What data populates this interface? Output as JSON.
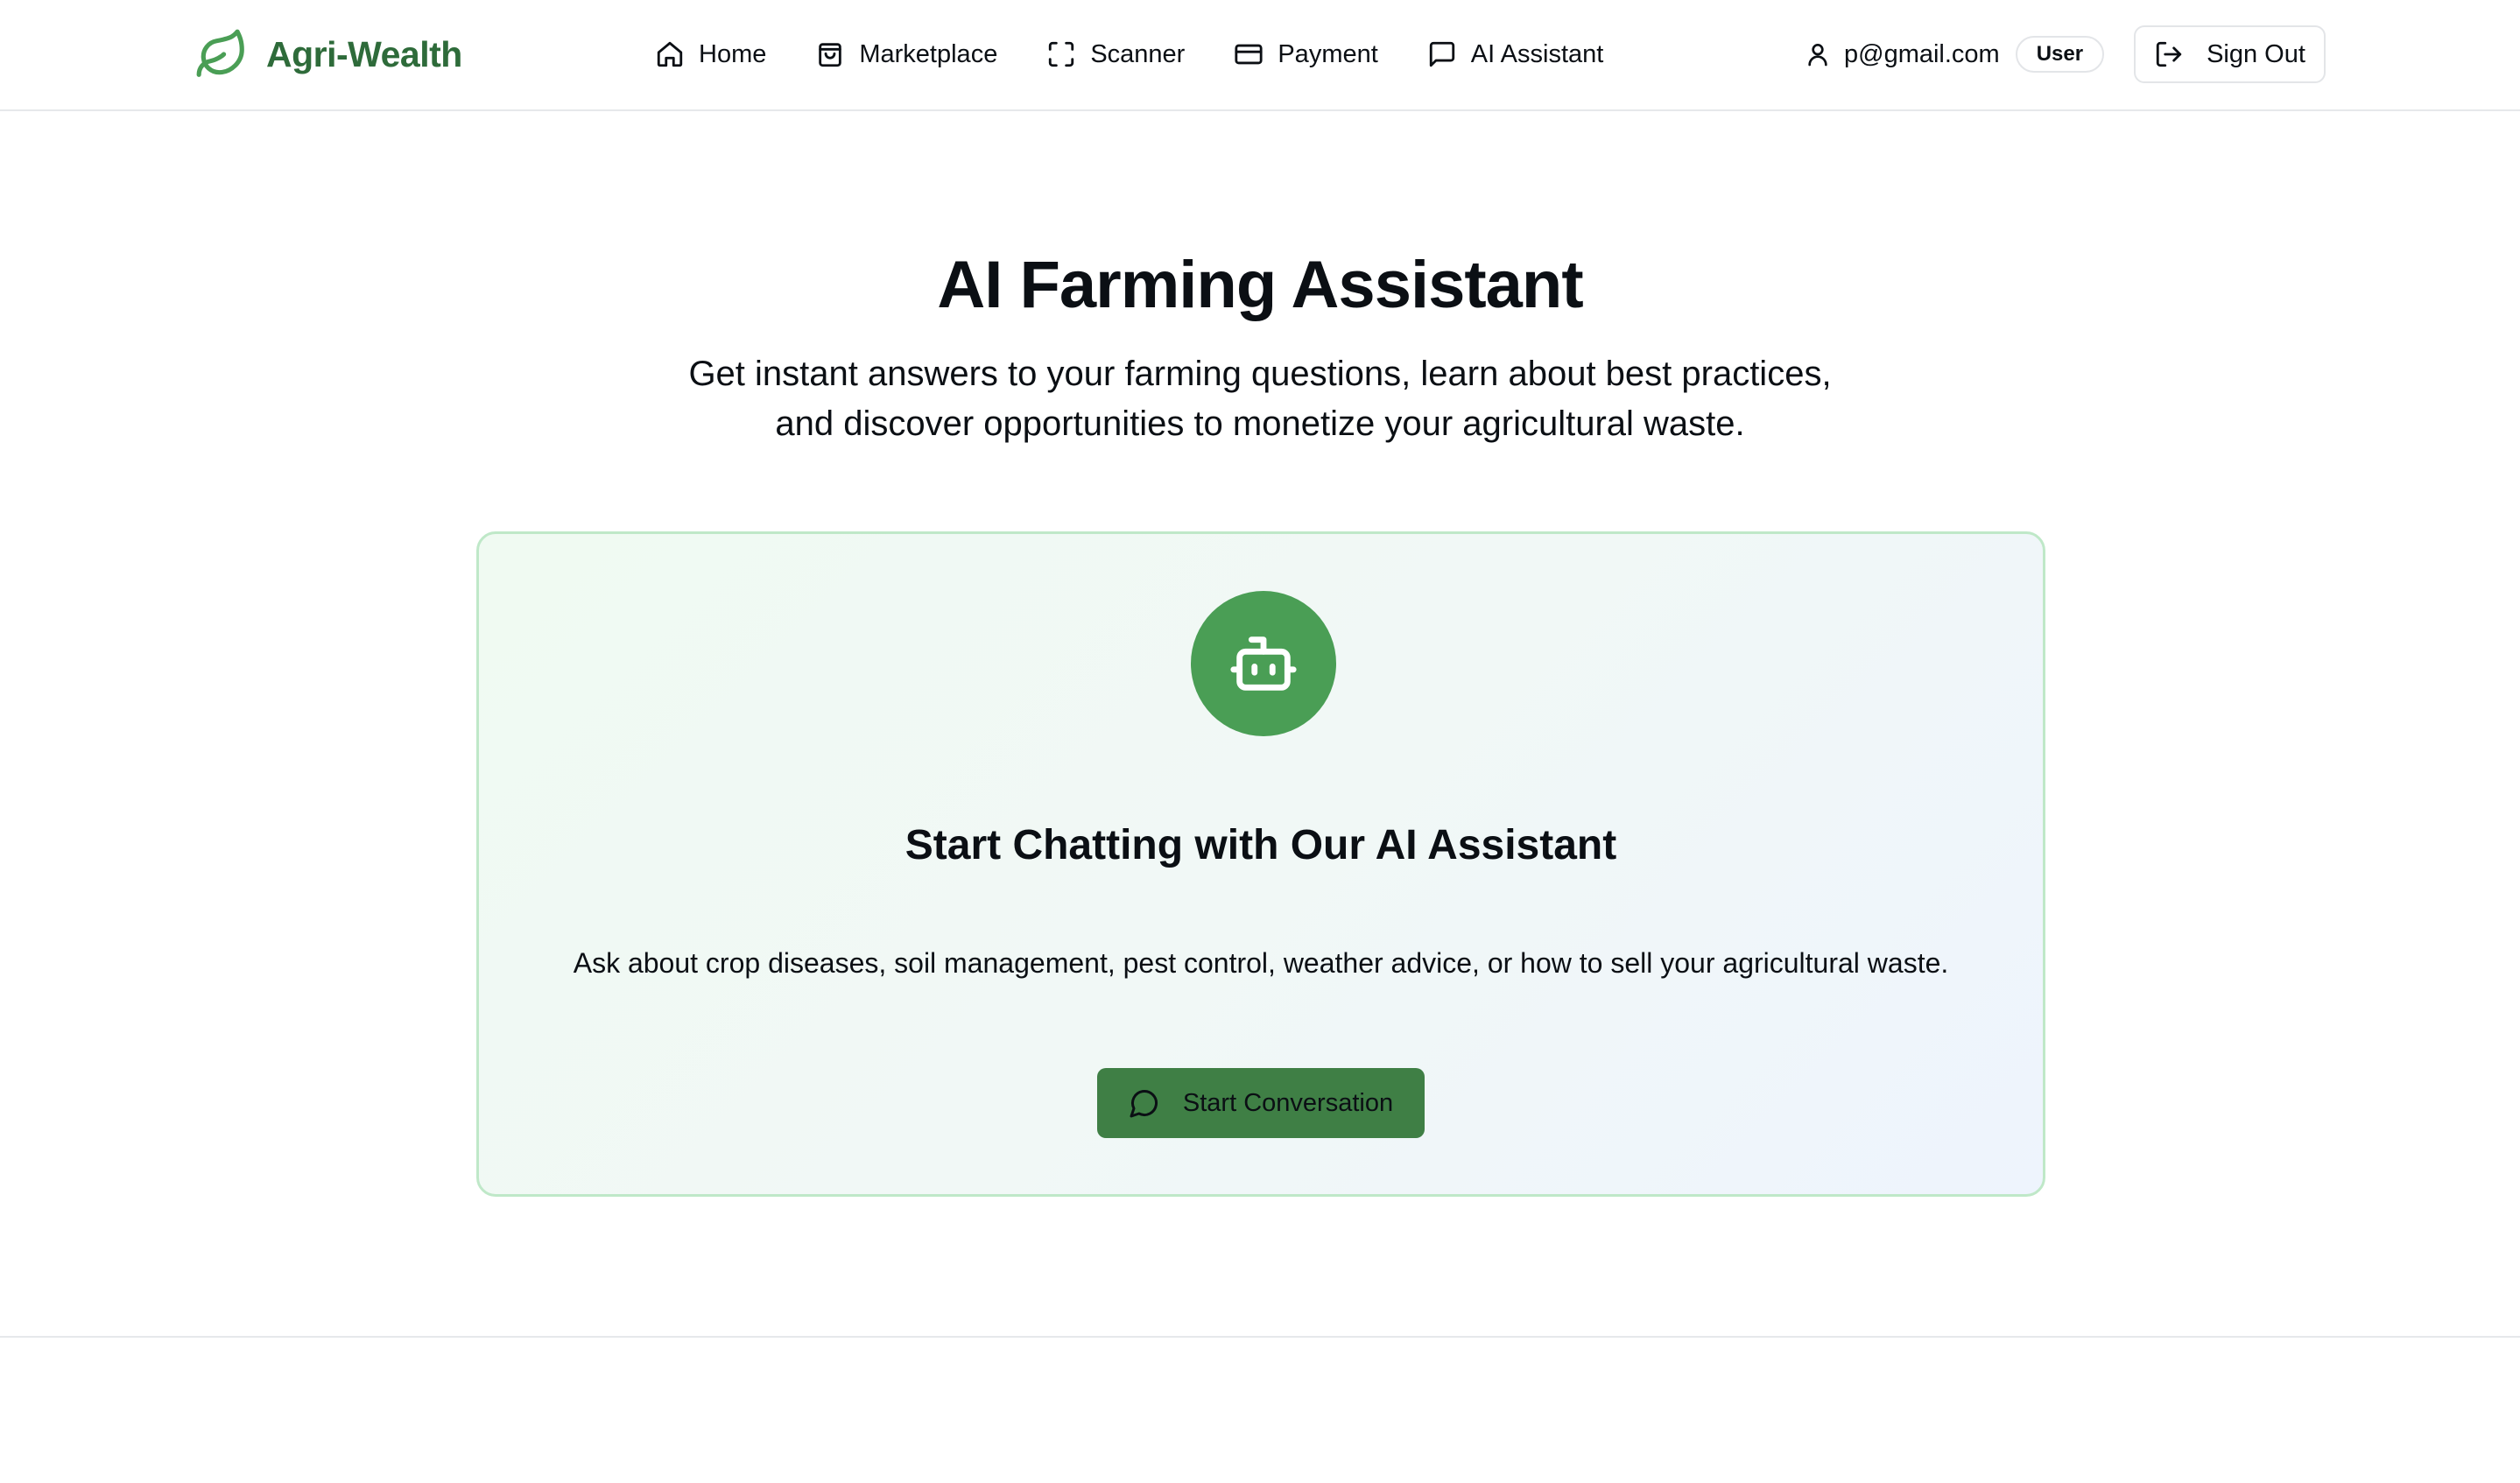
{
  "brand": {
    "name": "Agri-Wealth",
    "logo_icon": "leaf-icon",
    "color": "#2e6b3a"
  },
  "nav": {
    "items": [
      {
        "label": "Home",
        "icon": "home-icon"
      },
      {
        "label": "Marketplace",
        "icon": "shopping-bag-icon"
      },
      {
        "label": "Scanner",
        "icon": "scan-icon"
      },
      {
        "label": "Payment",
        "icon": "credit-card-icon"
      },
      {
        "label": "AI Assistant",
        "icon": "chat-square-icon"
      }
    ]
  },
  "user": {
    "email": "p@gmail.com",
    "role": "User",
    "icon": "user-icon"
  },
  "signout": {
    "label": "Sign Out",
    "icon": "log-out-icon"
  },
  "hero": {
    "title": "AI Farming Assistant",
    "subtitle_line1": "Get instant answers to your farming questions, learn about best practices,",
    "subtitle_line2": "and discover opportunities to monetize your agricultural waste."
  },
  "card": {
    "icon": "bot-icon",
    "title": "Start Chatting with Our AI Assistant",
    "description": "Ask about crop diseases, soil management, pest control, weather advice, or how to sell your agricultural waste.",
    "button_label": "Start Conversation",
    "button_icon": "message-circle-icon"
  },
  "colors": {
    "accent": "#4a9e55",
    "button": "#3f7f45",
    "card_border": "#bfe8c8"
  }
}
